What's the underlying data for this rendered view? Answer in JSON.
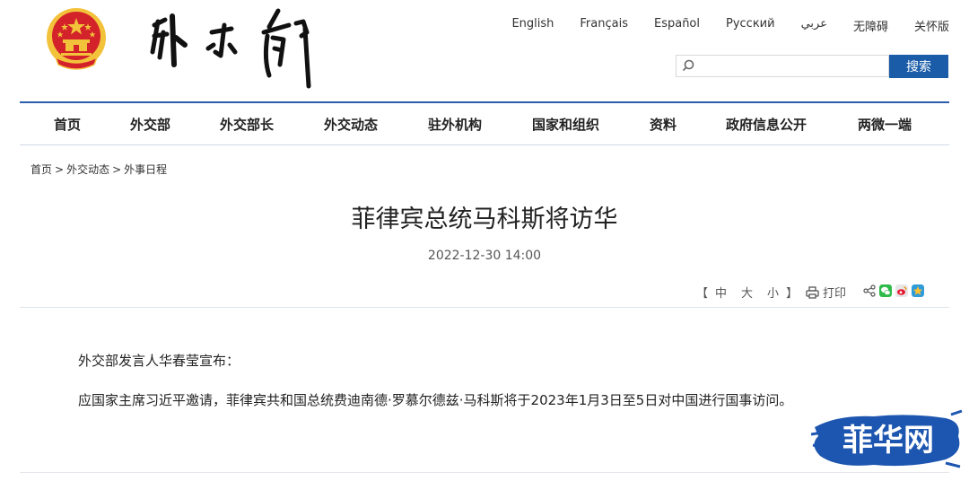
{
  "header": {
    "languages": [
      "English",
      "Français",
      "Español",
      "Русский",
      "عربي",
      "无障碍",
      "关怀版"
    ],
    "search": {
      "placeholder": "",
      "button_label": "搜索"
    }
  },
  "nav": {
    "items": [
      "首页",
      "外交部",
      "外交部长",
      "外交动态",
      "驻外机构",
      "国家和组织",
      "资料",
      "政府信息公开",
      "两微一端"
    ]
  },
  "breadcrumb": {
    "items": [
      "首页",
      "外交动态",
      "外事日程"
    ],
    "separator": ">"
  },
  "article": {
    "title": "菲律宾总统马科斯将访华",
    "date": "2022-12-30 14:00",
    "font_size_open": "【",
    "font_sizes": [
      "中",
      "大",
      "小"
    ],
    "font_size_close": "】",
    "print_label": "打印",
    "paragraphs": [
      "外交部发言人华春莹宣布：",
      "应国家主席习近平邀请，菲律宾共和国总统费迪南德·罗慕尔德兹·马科斯将于2023年1月3日至5日对中国进行国事访问。"
    ]
  },
  "watermark": {
    "text": "菲华网"
  },
  "colors": {
    "nav_line": "#2a5ea9",
    "search_button": "#1a5ca8",
    "emblem_red": "#d3222a",
    "emblem_gold": "#f3c23b",
    "watermark_blue": "#1d56b0"
  }
}
